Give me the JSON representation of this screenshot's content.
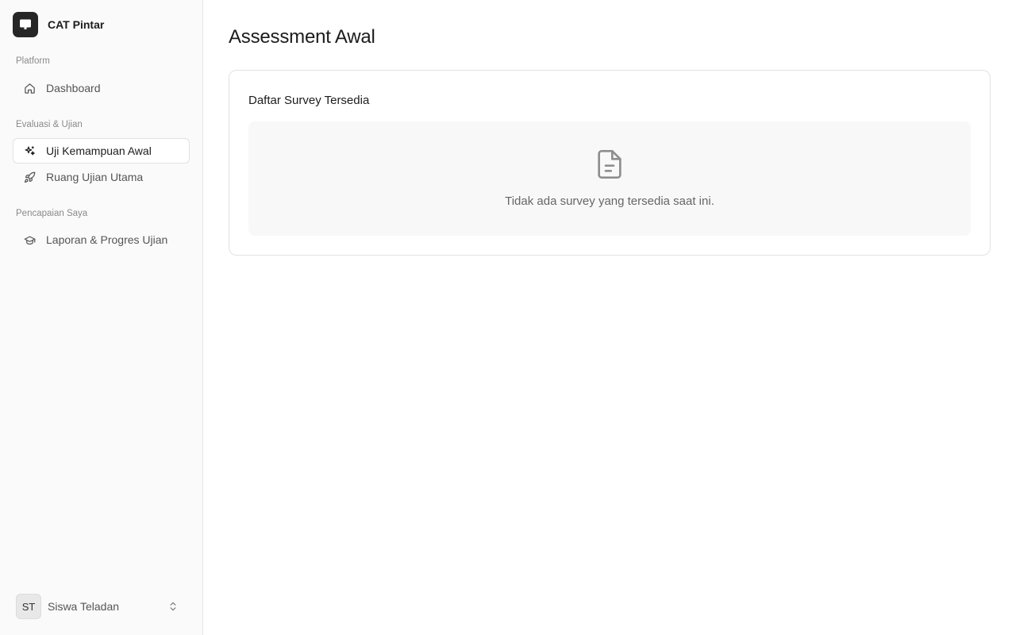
{
  "sidebar": {
    "brand_name": "CAT Pintar",
    "groups": [
      {
        "label": "Platform",
        "items": [
          {
            "label": "Dashboard",
            "icon": "home-icon"
          }
        ]
      },
      {
        "label": "Evaluasi & Ujian",
        "items": [
          {
            "label": "Uji Kemampuan Awal",
            "icon": "sparkles-icon",
            "active": true
          },
          {
            "label": "Ruang Ujian Utama",
            "icon": "rocket-icon"
          }
        ]
      },
      {
        "label": "Pencapaian Saya",
        "items": [
          {
            "label": "Laporan & Progres Ujian",
            "icon": "graduation-cap-icon"
          }
        ]
      }
    ],
    "user": {
      "initials": "ST",
      "name": "Siswa Teladan"
    }
  },
  "main": {
    "title": "Assessment Awal",
    "card": {
      "title": "Daftar Survey Tersedia",
      "empty_icon": "file-text-icon",
      "empty_text": "Tidak ada survey yang tersedia saat ini."
    }
  },
  "colors": {
    "sidebar_bg": "#fafafa",
    "logo_bg": "#262626",
    "empty_bg": "#f8f8f8",
    "border": "#e2e2e2"
  }
}
